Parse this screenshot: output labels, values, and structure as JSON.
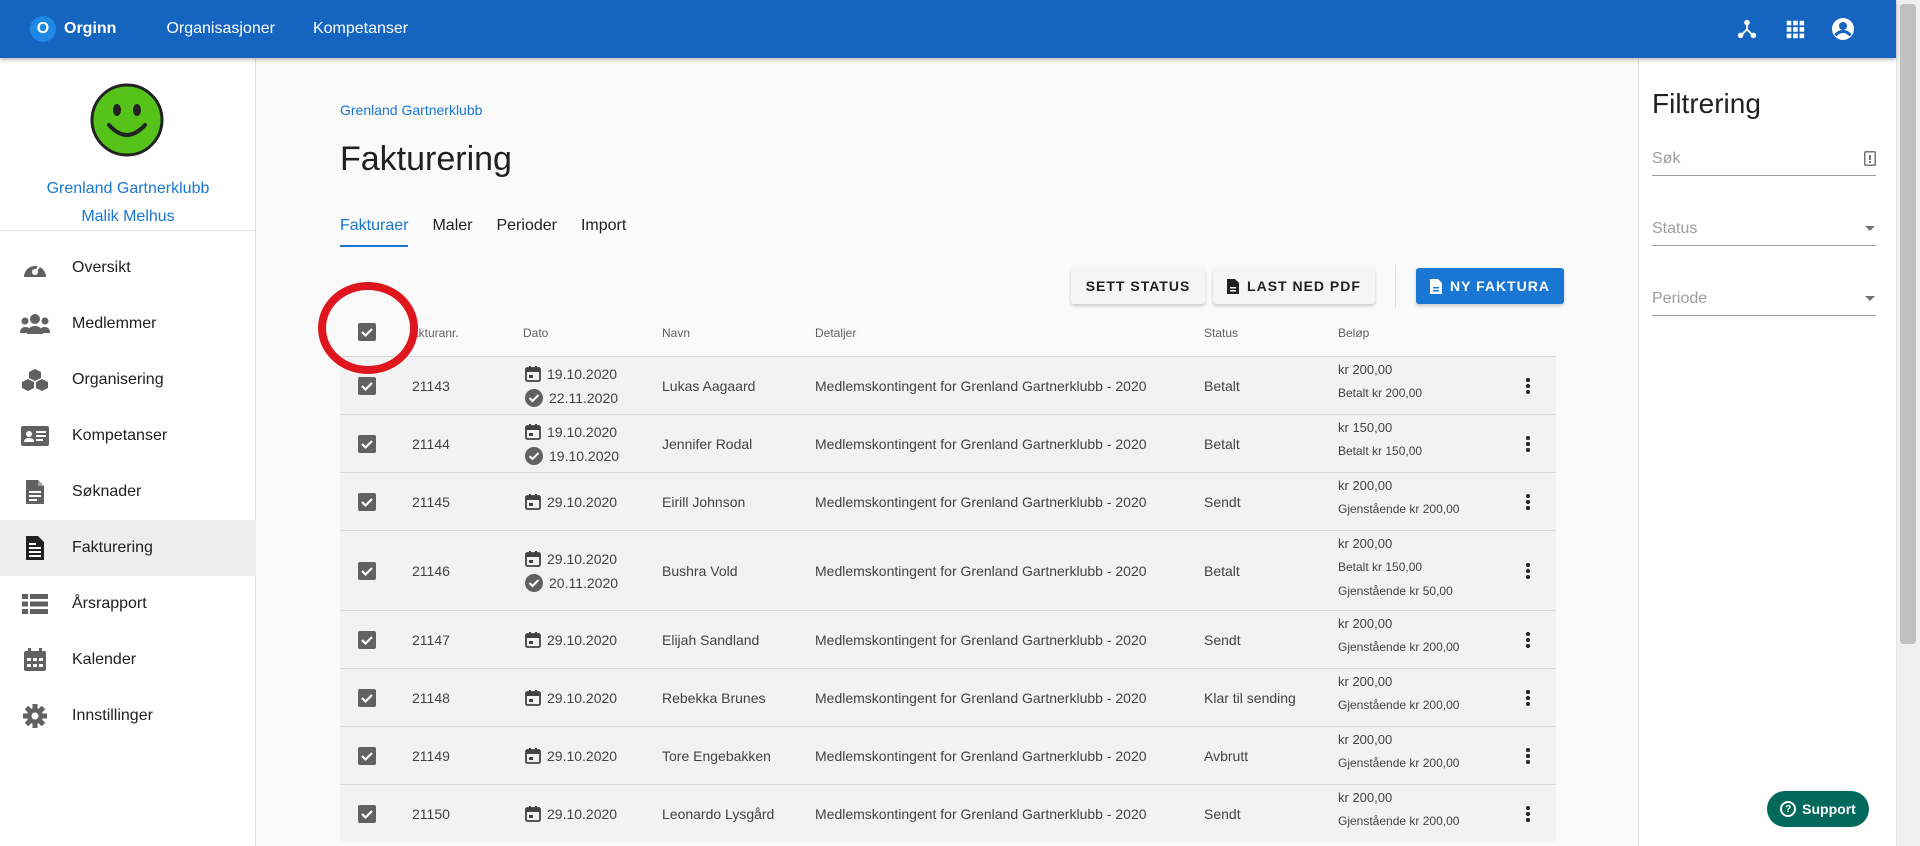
{
  "topbar": {
    "logo_letter": "O",
    "logo_text": "Orginn",
    "nav": [
      "Organisasjoner",
      "Kompetanser"
    ],
    "icons": [
      "hierarchy-icon",
      "apps-grid-icon",
      "account-circle-icon"
    ],
    "color": "#1565c0"
  },
  "sidebar": {
    "org_name": "Grenland Gartnerklubb",
    "user_name": "Malik Melhus",
    "items": [
      {
        "label": "Oversikt",
        "icon": "dashboard-icon"
      },
      {
        "label": "Medlemmer",
        "icon": "people-icon"
      },
      {
        "label": "Organisering",
        "icon": "cubes-icon"
      },
      {
        "label": "Kompetanser",
        "icon": "id-card-icon"
      },
      {
        "label": "Søknader",
        "icon": "document-icon"
      },
      {
        "label": "Fakturering",
        "icon": "invoice-icon",
        "active": true
      },
      {
        "label": "Årsrapport",
        "icon": "list-icon"
      },
      {
        "label": "Kalender",
        "icon": "calendar-icon"
      },
      {
        "label": "Innstillinger",
        "icon": "gear-icon"
      }
    ]
  },
  "main": {
    "breadcrumb": "Grenland Gartnerklubb",
    "title": "Fakturering",
    "tabs": [
      {
        "label": "Fakturaer",
        "active": true
      },
      {
        "label": "Maler"
      },
      {
        "label": "Perioder"
      },
      {
        "label": "Import"
      }
    ],
    "buttons": {
      "set_status": "SETT STATUS",
      "download_pdf": "LAST NED PDF",
      "new_invoice": "NY FAKTURA"
    },
    "table": {
      "headers": [
        "akturanr.",
        "Dato",
        "Navn",
        "Detaljer",
        "Status",
        "Beløp"
      ],
      "rows": [
        {
          "nr": "21143",
          "dates": [
            {
              "type": "calendar",
              "value": "19.10.2020"
            },
            {
              "type": "check",
              "value": "22.11.2020"
            }
          ],
          "name": "Lukas Aagaard",
          "details": "Medlemskontingent for Grenland Gartnerklubb - 2020",
          "status": "Betalt",
          "amounts": [
            "kr 200,00",
            "Betalt kr 200,00"
          ]
        },
        {
          "nr": "21144",
          "dates": [
            {
              "type": "calendar",
              "value": "19.10.2020"
            },
            {
              "type": "check",
              "value": "19.10.2020"
            }
          ],
          "name": "Jennifer Rodal",
          "details": "Medlemskontingent for Grenland Gartnerklubb - 2020",
          "status": "Betalt",
          "amounts": [
            "kr 150,00",
            "Betalt kr 150,00"
          ]
        },
        {
          "nr": "21145",
          "dates": [
            {
              "type": "calendar",
              "value": "29.10.2020"
            }
          ],
          "name": "Eirill Johnson",
          "details": "Medlemskontingent for Grenland Gartnerklubb - 2020",
          "status": "Sendt",
          "amounts": [
            "kr 200,00",
            "Gjenstående kr 200,00"
          ]
        },
        {
          "nr": "21146",
          "dates": [
            {
              "type": "calendar",
              "value": "29.10.2020"
            },
            {
              "type": "check",
              "value": "20.11.2020"
            }
          ],
          "name": "Bushra Vold",
          "details": "Medlemskontingent for Grenland Gartnerklubb - 2020",
          "status": "Betalt",
          "amounts": [
            "kr 200,00",
            "Betalt kr 150,00",
            "Gjenstående kr 50,00"
          ]
        },
        {
          "nr": "21147",
          "dates": [
            {
              "type": "calendar",
              "value": "29.10.2020"
            }
          ],
          "name": "Elijah Sandland",
          "details": "Medlemskontingent for Grenland Gartnerklubb - 2020",
          "status": "Sendt",
          "amounts": [
            "kr 200,00",
            "Gjenstående kr 200,00"
          ]
        },
        {
          "nr": "21148",
          "dates": [
            {
              "type": "calendar",
              "value": "29.10.2020"
            }
          ],
          "name": "Rebekka Brunes",
          "details": "Medlemskontingent for Grenland Gartnerklubb - 2020",
          "status": "Klar til sending",
          "amounts": [
            "kr 200,00",
            "Gjenstående kr 200,00"
          ]
        },
        {
          "nr": "21149",
          "dates": [
            {
              "type": "calendar",
              "value": "29.10.2020"
            }
          ],
          "name": "Tore Engebakken",
          "details": "Medlemskontingent for Grenland Gartnerklubb - 2020",
          "status": "Avbrutt",
          "amounts": [
            "kr 200,00",
            "Gjenstående kr 200,00"
          ]
        },
        {
          "nr": "21150",
          "dates": [
            {
              "type": "calendar",
              "value": "29.10.2020"
            }
          ],
          "name": "Leonardo Lysgård",
          "details": "Medlemskontingent for Grenland Gartnerklubb - 2020",
          "status": "Sendt",
          "amounts": [
            "kr 200,00",
            "Gjenstående kr 200,00"
          ]
        }
      ]
    }
  },
  "filter": {
    "title": "Filtrering",
    "search_placeholder": "Søk",
    "status_label": "Status",
    "period_label": "Periode",
    "support_label": "Support"
  },
  "colors": {
    "primary": "#1976d2",
    "annotation": "#e0161e",
    "support": "#00695c"
  }
}
